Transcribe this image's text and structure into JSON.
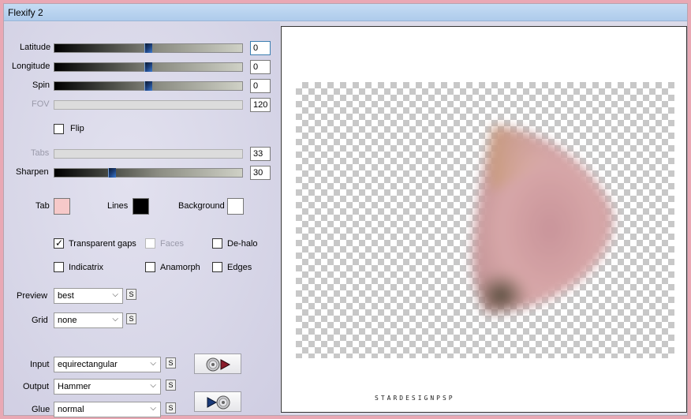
{
  "window": {
    "title": "Flexify 2"
  },
  "sliders": {
    "latitude": {
      "label": "Latitude",
      "value": "0",
      "fraction": 0.5
    },
    "longitude": {
      "label": "Longitude",
      "value": "0",
      "fraction": 0.5
    },
    "spin": {
      "label": "Spin",
      "value": "0",
      "fraction": 0.5
    },
    "fov": {
      "label": "FOV",
      "value": "120"
    },
    "tabs": {
      "label": "Tabs",
      "value": "33"
    },
    "sharpen": {
      "label": "Sharpen",
      "value": "30",
      "fraction": 0.3
    }
  },
  "flip": {
    "label": "Flip",
    "checked": false
  },
  "colors": {
    "tab": {
      "label": "Tab",
      "color": "#f6c9c9"
    },
    "lines": {
      "label": "Lines",
      "color": "#000000"
    },
    "background": {
      "label": "Background",
      "color": "#ffffff"
    }
  },
  "options": {
    "transparent_gaps": {
      "label": "Transparent gaps",
      "checked": true
    },
    "faces": {
      "label": "Faces",
      "checked": false,
      "disabled": true
    },
    "de_halo": {
      "label": "De-halo",
      "checked": false
    },
    "indicatrix": {
      "label": "Indicatrix",
      "checked": false
    },
    "anamorph": {
      "label": "Anamorph",
      "checked": false
    },
    "edges": {
      "label": "Edges",
      "checked": false
    }
  },
  "preview": {
    "label": "Preview",
    "value": "best"
  },
  "grid": {
    "label": "Grid",
    "value": "none"
  },
  "input": {
    "label": "Input",
    "value": "equirectangular"
  },
  "output": {
    "label": "Output",
    "value": "Hammer"
  },
  "glue": {
    "label": "Glue",
    "value": "normal"
  },
  "s_button_label": "S",
  "watermark": "STARDESIGNPSP",
  "icons": {
    "check": "check-icon",
    "chevron": "chevron-down-icon",
    "input_to_output": "cd-to-play-icon",
    "output_to_input": "play-to-cd-icon"
  }
}
